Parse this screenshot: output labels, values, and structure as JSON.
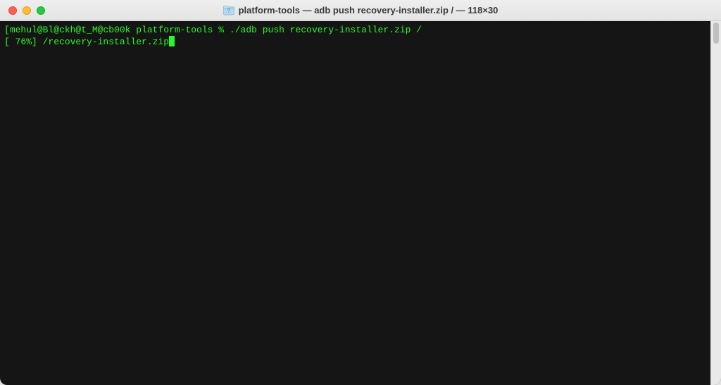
{
  "titlebar": {
    "title": "platform-tools — adb push recovery-installer.zip / — 118×30"
  },
  "terminal": {
    "line1_prompt_user": "mehul@Bl@ckh@t_M@cb00k",
    "line1_space1": " ",
    "line1_dir": "platform-tools",
    "line1_space2": " ",
    "line1_percent": "%",
    "line1_space3": " ",
    "line1_command": "./adb push recovery-installer.zip /",
    "line2": "[ 76%] /recovery-installer.zip"
  },
  "colors": {
    "terminal_bg": "#151515",
    "terminal_green": "#29f729"
  }
}
